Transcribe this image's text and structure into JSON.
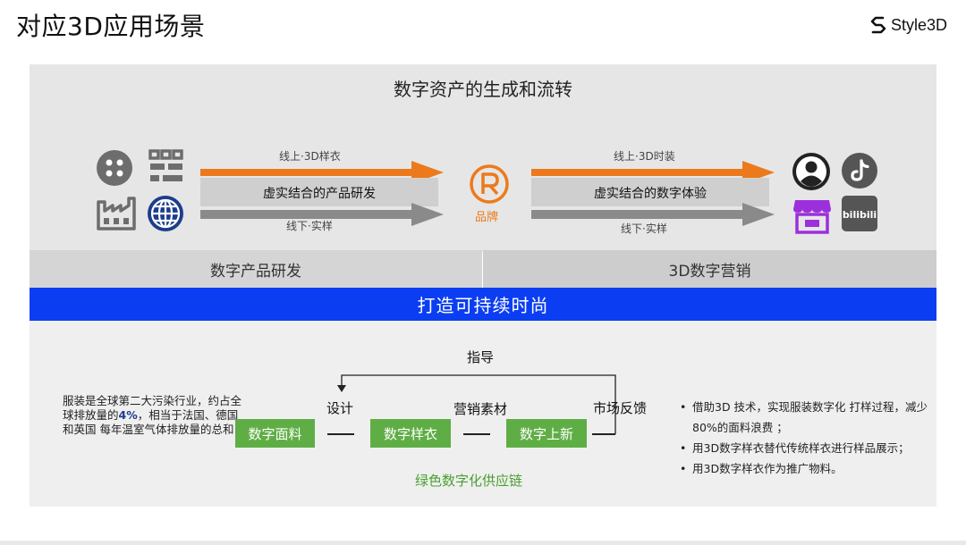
{
  "slide": {
    "title": "对应3D应用场景"
  },
  "logo": {
    "text": "Style3D"
  },
  "flow": {
    "title": "数字资产的生成和流转",
    "left": {
      "top_label": "线上·3D样衣",
      "band": "虚实结合的产品研发",
      "bottom_label": "线下·实样"
    },
    "center": {
      "label": "品牌"
    },
    "right": {
      "top_label": "线上·3D时装",
      "band": "虚实结合的数字体验",
      "bottom_label": "线下·实样"
    }
  },
  "columns": {
    "left": "数字产品研发",
    "right": "3D数字营销"
  },
  "banner": "打造可持续时尚",
  "bottom": {
    "note_pre": "服装是全球第二大污染行业，约占全球排放量的",
    "note_highlight": "4%",
    "note_post": "，相当于法国、德国和英国 每年温室气体排放量的总和",
    "guide_label": "指导",
    "steps": {
      "design": "设计",
      "marketing": "营销素材",
      "feedback": "市场反馈"
    },
    "boxes": {
      "fabric": "数字面料",
      "sample": "数字样衣",
      "launch": "数字上新"
    },
    "chain_label": "绿色数字化供应链",
    "bullets": [
      "借助3D 技术，实现服装数字化 打样过程，减少80%的面料浪费 ；",
      "用3D数字样衣替代传统样衣进行样品展示；",
      "用3D数字样衣作为推广物料。"
    ]
  },
  "colors": {
    "orange": "#ec7a1c",
    "blue": "#0b3ef2",
    "green": "#5fae45",
    "purple": "#8a2be2"
  }
}
